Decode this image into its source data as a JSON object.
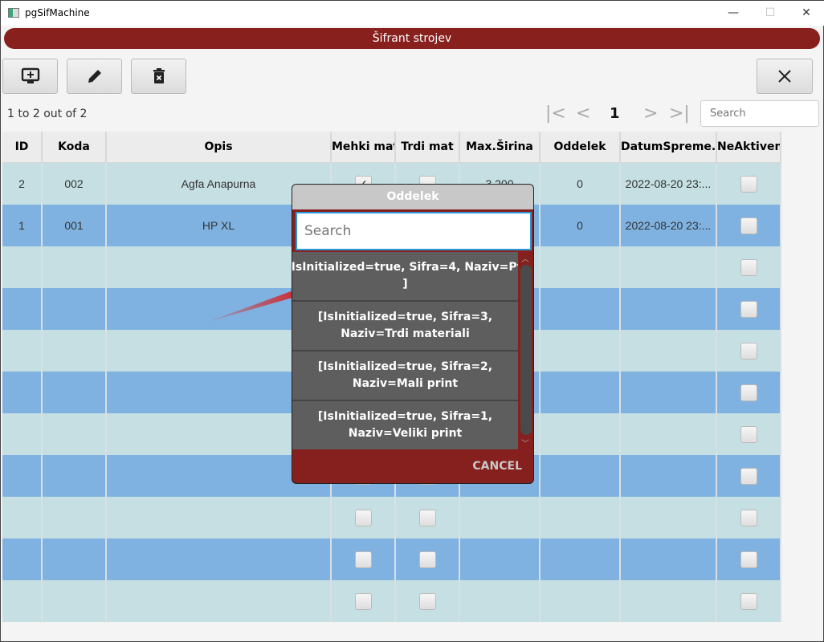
{
  "window": {
    "title": "pgSifMachine",
    "minimize": "—",
    "maximize": "☐",
    "close": "✕"
  },
  "banner": "Šifrant strojev",
  "toolbar": {
    "add_icon": "monitor-plus-icon",
    "edit_icon": "pencil-icon",
    "delete_icon": "trash-icon",
    "close_icon": "close-icon"
  },
  "pager": {
    "count": "1 to 2 out of 2",
    "first": "|<",
    "prev": "<",
    "page": "1",
    "next": ">",
    "last": ">|",
    "search_placeholder": "Search"
  },
  "table": {
    "columns": [
      "ID",
      "Koda",
      "Opis",
      "Mehki mat",
      "Trdi mat",
      "Max.Širina",
      "Oddelek",
      "DatumSpreme...",
      "NeAktiven"
    ],
    "rows": [
      {
        "id": "2",
        "koda": "002",
        "opis": "Agfa Anapurna",
        "mehki": true,
        "trdi": false,
        "max": "3,200",
        "oddelek": "0",
        "datum": "2022-08-20 23:...",
        "neaktiven": false
      },
      {
        "id": "1",
        "koda": "001",
        "opis": "HP XL",
        "mehki": false,
        "trdi": false,
        "max": "",
        "oddelek": "0",
        "datum": "2022-08-20 23:...",
        "neaktiven": false
      }
    ]
  },
  "dialog": {
    "title": "Oddelek",
    "search_placeholder": "Search",
    "cancel": "CANCEL",
    "items": [
      "[IsInitialized=true, Sifra=4, Naziv=Pv ]",
      "[IsInitialized=true, Sifra=3, Naziv=Trdi materiali",
      "[IsInitialized=true, Sifra=2, Naziv=Mali print",
      "[IsInitialized=true, Sifra=1, Naziv=Veliki print"
    ]
  },
  "colors": {
    "accent": "#88201e",
    "row_light": "#c5dfe2",
    "row_blue": "#7fb2e0",
    "annotation_arrow": "#e01010"
  }
}
